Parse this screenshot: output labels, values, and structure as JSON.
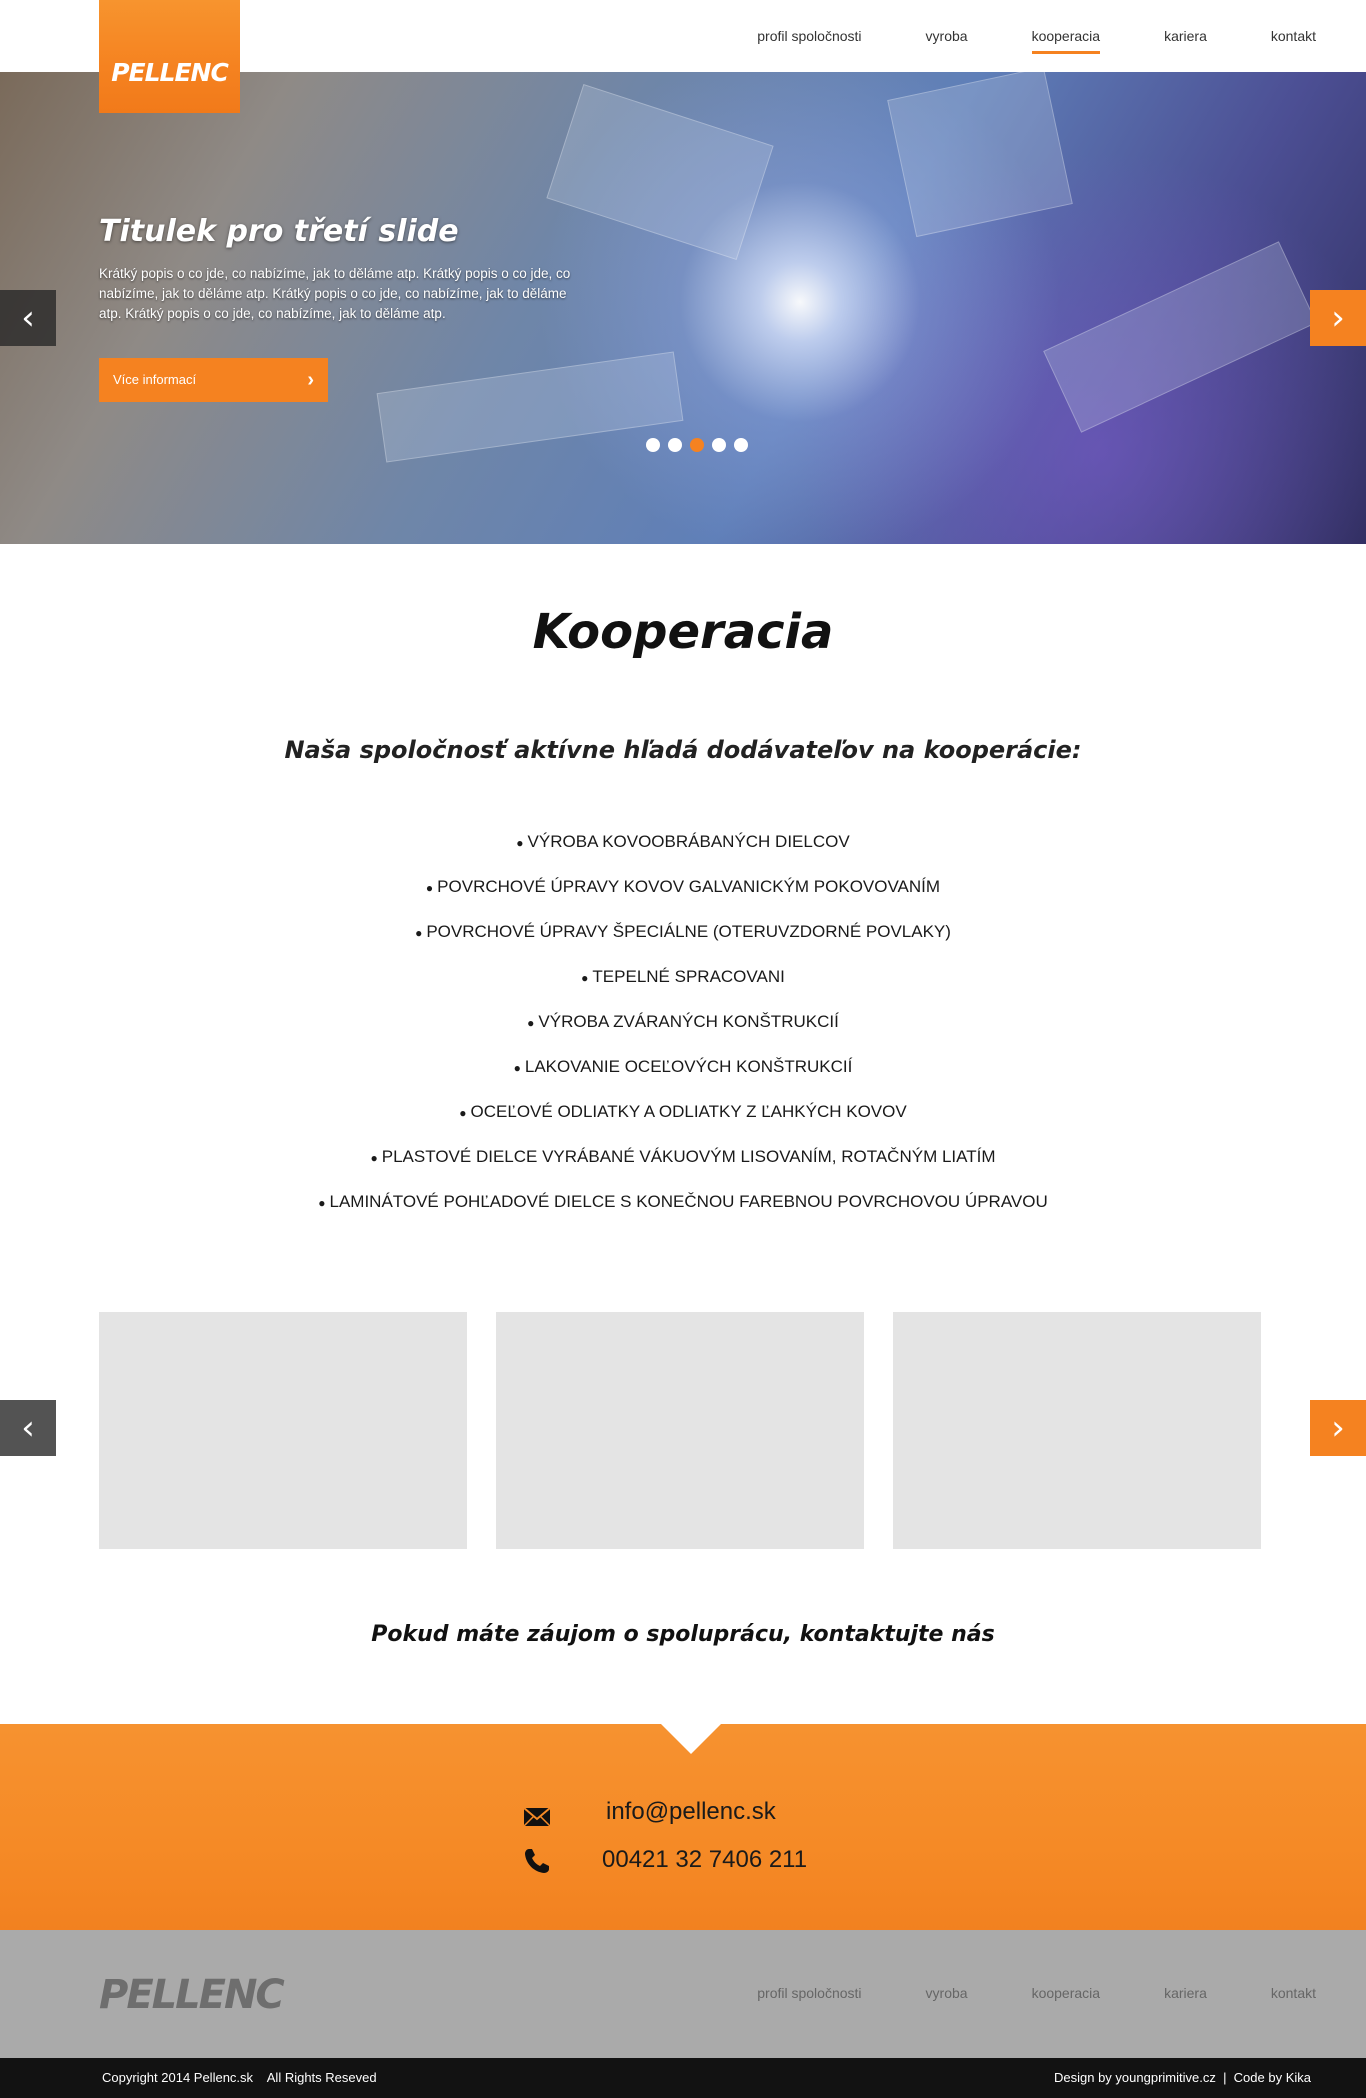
{
  "brand": {
    "logo": "PELLENC",
    "accent": "#f58220"
  },
  "nav": [
    {
      "label": "profil spoločnosti",
      "active": false
    },
    {
      "label": "vyroba",
      "active": false
    },
    {
      "label": "kooperacia",
      "active": true
    },
    {
      "label": "kariera",
      "active": false
    },
    {
      "label": "kontakt",
      "active": false
    }
  ],
  "hero": {
    "title": "Titulek pro třetí slide",
    "description": "Krátký popis o co jde, co nabízíme, jak to děláme atp. Krátký popis o co jde, co nabízíme, jak to děláme atp. Krátký popis o co jde, co nabízíme, jak to děláme atp. Krátký popis o co jde, co nabízíme, jak to děláme atp.",
    "button_label": "Více informací",
    "prev_icon": "chevron-left-icon",
    "next_icon": "chevron-right-icon",
    "slide_count": 5,
    "active_slide": 3
  },
  "main": {
    "title": "Kooperacia",
    "subtitle": "Naša spoločnosť aktívne hľadá dodávateľov na kooperácie:",
    "items": [
      "VÝROBA KOVOOBRÁBANÝCH DIELCOV",
      "POVRCHOVÉ ÚPRAVY KOVOV GALVANICKÝM POKOVOVANÍM",
      "POVRCHOVÉ ÚPRAVY ŠPECIÁLNE (OTERUVZDORNÉ POVLAKY)",
      "TEPELNÉ SPRACOVANI",
      "VÝROBA ZVÁRANÝCH KONŠTRUKCIÍ",
      "LAKOVANIE OCEĽOVÝCH KONŠTRUKCIÍ",
      "OCEĽOVÉ ODLIATKY A ODLIATKY Z ĽAHKÝCH KOVOV",
      "PLASTOVÉ DIELCE VYRÁBANÉ  VÁKUOVÝM LISOVANÍM, ROTAČNÝM LIATÍM",
      "LAMINÁTOVÉ POHĽADOVÉ DIELCE S KONEČNOU FAREBNOU POVRCHOVOU ÚPRAVOU"
    ],
    "cta": "Pokud máte záujom o spoluprácu, kontaktujte nás"
  },
  "contact": {
    "email": "info@pellenc.sk",
    "phone": "00421 32 7406 211",
    "email_icon": "envelope-icon",
    "phone_icon": "phone-icon"
  },
  "footer": {
    "logo": "PELLENC",
    "nav": [
      "profil spoločnosti",
      "vyroba",
      "kooperacia",
      "kariera",
      "kontakt"
    ],
    "copyright": "Copyright 2014 Pellenc.sk    All Rights Reseved",
    "credits": "Design by youngprimitive.cz  |  Code by Kika"
  }
}
